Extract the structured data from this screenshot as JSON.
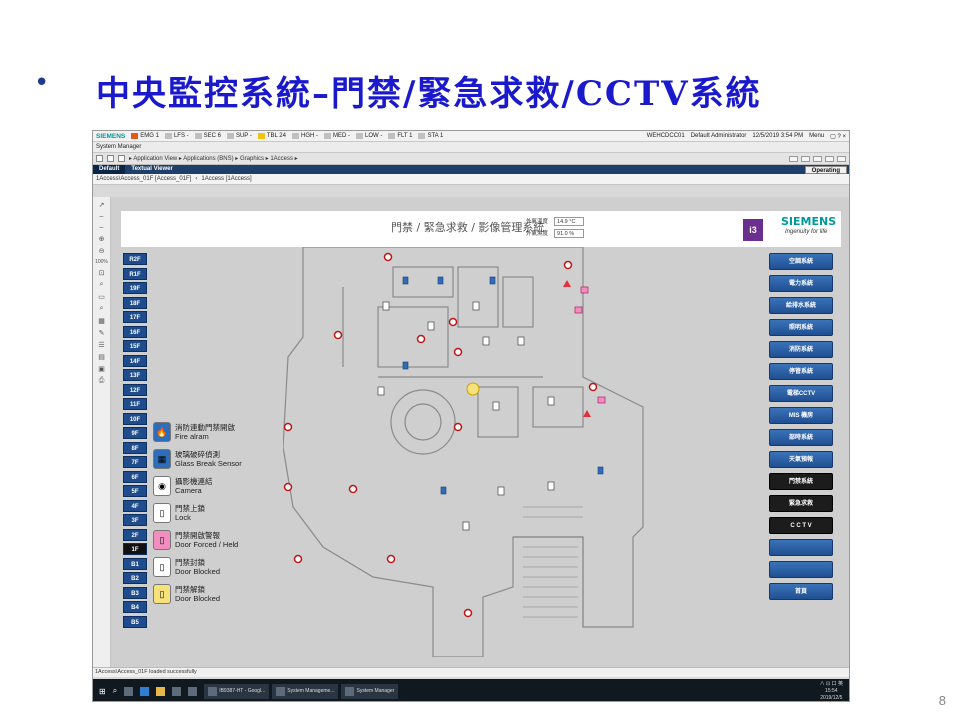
{
  "slide": {
    "bullet": "•",
    "title": "中央監控系統–門禁/緊急求救/CCTV系統",
    "page_number": "8"
  },
  "topbar": {
    "brand": "SIEMENS",
    "alarms": [
      {
        "label": "EMG 1",
        "color": "#e05a1c"
      },
      {
        "label": "LFS -",
        "color": "#c0c0c0"
      },
      {
        "label": "SEC 6",
        "color": "#c0c0c0"
      },
      {
        "label": "SUP -",
        "color": "#c0c0c0"
      },
      {
        "label": "TBL 24",
        "color": "#f2c40f"
      },
      {
        "label": "HGH -",
        "color": "#c0c0c0"
      },
      {
        "label": "MED -",
        "color": "#c0c0c0"
      },
      {
        "label": "LOW -",
        "color": "#c0c0c0"
      },
      {
        "label": "FLT 1",
        "color": "#c0c0c0"
      },
      {
        "label": "STA 1",
        "color": "#c0c0c0"
      }
    ],
    "host": "WEHCDCC01",
    "user": "Default Administrator",
    "datetime": "12/5/2019 3:54 PM",
    "menu": "Menu"
  },
  "appbar": {
    "title": "System Manager"
  },
  "navbar": {
    "breadcrumb": "▸ Application View ▸ Applications (BNS) ▸ Graphics ▸ 1Access ▸"
  },
  "viewtabs": {
    "default": "Default",
    "textual": "Textual Viewer",
    "mode": "Operating"
  },
  "pathbar": {
    "path": "1Access\\Access_01F [Access_01F]",
    "sep": "‹",
    "sub": "1Access [1Access]"
  },
  "tools": {
    "zoom": "100%"
  },
  "header": {
    "title": "門禁 / 緊急求救 / 影像管理系統",
    "temp_label": "外氣溫度",
    "temp_value": "14.9 °C",
    "hum_label": "外氣濕度",
    "hum_value": "91.0 %",
    "mini_logo": "i3",
    "brand": "SIEMENS",
    "tagline": "Ingenuity for life"
  },
  "floors": [
    "R2F",
    "R1F",
    "19F",
    "18F",
    "17F",
    "16F",
    "15F",
    "14F",
    "13F",
    "12F",
    "11F",
    "10F",
    "9F",
    "8F",
    "7F",
    "6F",
    "5F",
    "4F",
    "3F",
    "2F",
    "1F",
    "B1",
    "B2",
    "B3",
    "B4",
    "B5"
  ],
  "active_floor": "1F",
  "legend": [
    {
      "zh": "消防連動門禁開啟",
      "en": "Fire alram",
      "bg": "#2f6db8",
      "icon": "🔥"
    },
    {
      "zh": "玻璃破碎偵測",
      "en": "Glass Break Sensor",
      "bg": "#2f6db8",
      "icon": "▦"
    },
    {
      "zh": "攝影機連結",
      "en": "Camera",
      "bg": "#ffffff",
      "icon": "◉"
    },
    {
      "zh": "門禁上鎖",
      "en": "Lock",
      "bg": "#ffffff",
      "icon": "▯"
    },
    {
      "zh": "門禁開啟警報",
      "en": "Door Forced / Held",
      "bg": "#f28dc0",
      "icon": "▯"
    },
    {
      "zh": "門禁封鎖",
      "en": "Door Blocked",
      "bg": "#ffffff",
      "icon": "▯"
    },
    {
      "zh": "門禁解鎖",
      "en": "Door Blocked",
      "bg": "#f5e27a",
      "icon": "▯"
    }
  ],
  "systems": [
    {
      "label": "空調系統",
      "dark": false
    },
    {
      "label": "電力系統",
      "dark": false
    },
    {
      "label": "給排水系統",
      "dark": false
    },
    {
      "label": "照明系統",
      "dark": false
    },
    {
      "label": "消防系統",
      "dark": false
    },
    {
      "label": "停管系統",
      "dark": false
    },
    {
      "label": "電梯CCTV",
      "dark": false
    },
    {
      "label": "MIS 機房",
      "dark": false
    },
    {
      "label": "部時系統",
      "dark": false
    },
    {
      "label": "天氣預報",
      "dark": false
    },
    {
      "label": "門禁系統",
      "dark": true
    },
    {
      "label": "緊急求救",
      "dark": true
    },
    {
      "label": "C C T V",
      "dark": true
    },
    {
      "label": "",
      "dark": false
    },
    {
      "label": "",
      "dark": false
    },
    {
      "label": "首頁",
      "dark": false
    }
  ],
  "status": {
    "message": "1Access\\Access_01F loaded successfully"
  },
  "taskbar": {
    "tasks": [
      "IB9387-HT - Googl...",
      "System Manageme...",
      "System Manager"
    ],
    "time": "15:54",
    "date": "2019/12/5",
    "ime": "英",
    "tray_text": "∧ ⊡ 口"
  }
}
